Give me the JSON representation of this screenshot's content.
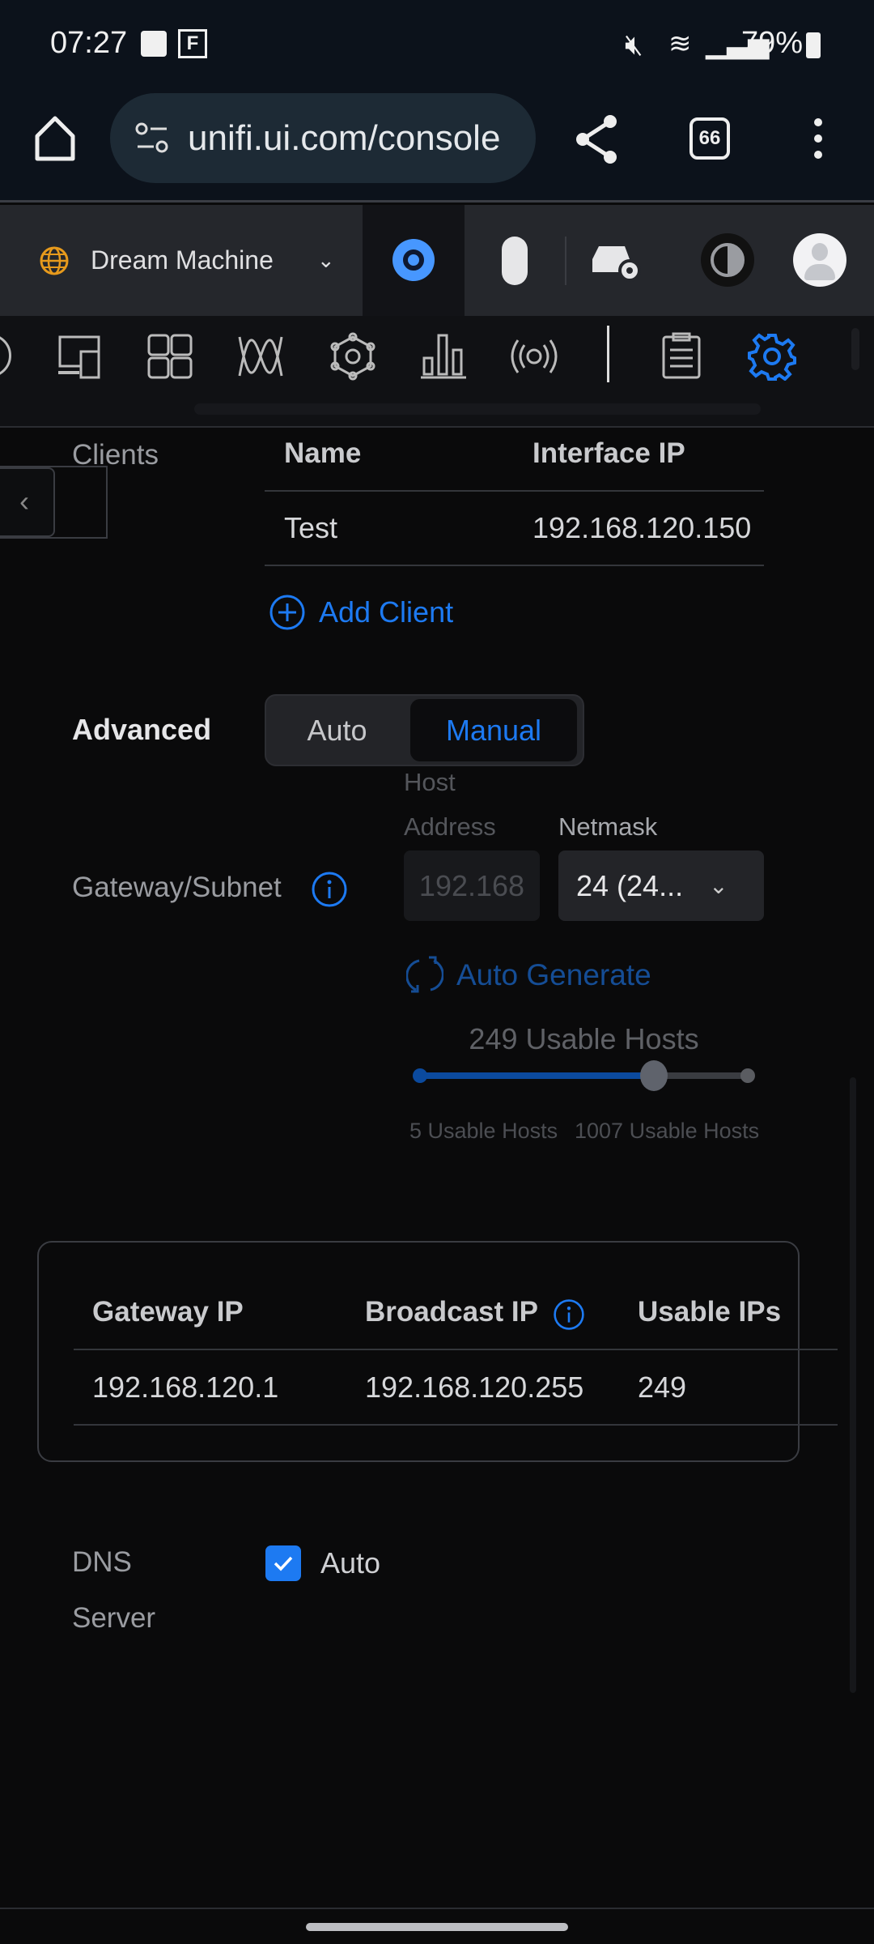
{
  "status_bar": {
    "time": "07:27",
    "notif_f": "F",
    "battery": "79%"
  },
  "browser": {
    "url": "unifi.ui.com/console",
    "tab_count": "66"
  },
  "topbar": {
    "site_name": "Dream Machine"
  },
  "clients": {
    "label": "Clients",
    "columns": [
      "Name",
      "Interface IP"
    ],
    "rows": [
      {
        "name": "Test",
        "ip": "192.168.120.150"
      }
    ],
    "add_label": "Add Client"
  },
  "advanced": {
    "label": "Advanced",
    "options": [
      "Auto",
      "Manual"
    ],
    "selected": "Manual"
  },
  "gateway": {
    "label": "Gateway/Subnet",
    "host_label_1": "Host",
    "host_label_2": "Address",
    "host_value": "192.168",
    "netmask_label": "Netmask",
    "netmask_value": "24 (24...",
    "auto_generate": "Auto Generate",
    "usable_hosts": "249 Usable Hosts",
    "slider_min": "5 Usable Hosts",
    "slider_max": "1007 Usable Hosts",
    "slider_fraction": 0.71
  },
  "summary": {
    "columns": [
      "Gateway IP",
      "Broadcast IP",
      "Usable IPs"
    ],
    "values": [
      "192.168.120.1",
      "192.168.120.255",
      "249"
    ]
  },
  "dns": {
    "label_1": "DNS",
    "label_2": "Server",
    "auto_label": "Auto",
    "auto_checked": true
  },
  "colors": {
    "accent": "#1d7af2",
    "background": "#0a0a0b"
  }
}
